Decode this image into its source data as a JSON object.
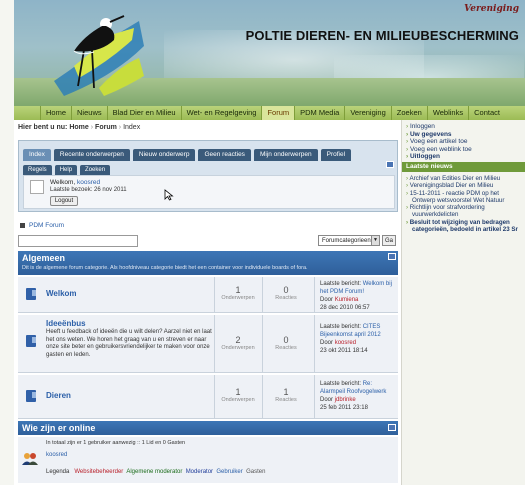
{
  "header": {
    "site_sup": "Vereniging",
    "site_title": "POLTIE DIEREN- EN MILIEUBESCHERMING"
  },
  "nav": {
    "items": [
      "Home",
      "Nieuws",
      "Blad Dier en Milieu",
      "Wet- en Regelgeving",
      "Forum",
      "PDM Media",
      "Vereniging",
      "Zoeken",
      "Weblinks",
      "Contact"
    ],
    "active_index": 4
  },
  "breadcrumb": {
    "prefix": "Hier bent u nu:",
    "home": "Home",
    "forum": "Forum",
    "index": "Index"
  },
  "tabs": {
    "primary": [
      "Index",
      "Recente onderwerpen",
      "Nieuw onderwerp",
      "Geen reacties",
      "Mijn onderwerpen",
      "Profiel"
    ],
    "secondary": [
      "Regels",
      "Help",
      "Zoeken"
    ]
  },
  "user": {
    "welcome_label": "Welkom,",
    "username": "koosred",
    "last_visit": "Laatste bezoek: 26 nov 2011",
    "logout": "Logout"
  },
  "forum_link": "PDM Forum",
  "search": {
    "value": "",
    "select": "Forumcategorieen",
    "go": "Ga"
  },
  "category": {
    "title": "Algemeen",
    "description": "Dit is de algemene forum categorie. Als hoofdniveau categorie biedt het een container voor individuele boards of fora."
  },
  "forums": [
    {
      "name": "Welkom",
      "description": "",
      "topics": "1",
      "topics_label": "Onderwerpen",
      "replies": "0",
      "replies_label": "Reacties",
      "last_label": "Laatste bericht:",
      "last_title": "Welkom bij het PDM Forum!",
      "by_label": "Door",
      "last_user": "Kumiena",
      "last_date": "28 dec 2010 06:57"
    },
    {
      "name": "Ideeënbus",
      "description": "Heeft u feedback of ideeën die u wilt delen? Aarzel niet en laat het ons weten. We horen het graag van u en streven er naar onze site beter en gebruikersvriendelijker te maken voor onze gasten en leden.",
      "topics": "2",
      "topics_label": "Onderwerpen",
      "replies": "0",
      "replies_label": "Reacties",
      "last_label": "Laatste bericht:",
      "last_title": "CITES Bijeenkomst april 2012",
      "by_label": "Door",
      "last_user": "koosred",
      "last_date": "23 okt 2011 18:14"
    },
    {
      "name": "Dieren",
      "description": "",
      "topics": "1",
      "topics_label": "Onderwerpen",
      "replies": "1",
      "replies_label": "Reacties",
      "last_label": "Laatste bericht:",
      "last_title": "Re: Alarmpeil Roofvogelwerk",
      "by_label": "Door",
      "last_user": "jdbrinke",
      "last_date": "25 feb 2011 23:18"
    }
  ],
  "online": {
    "title": "Wie zijn er online",
    "summary": "In totaal zijn er 1 gebruiker aanwezig :: 1 Lid en 0 Gasten",
    "user": "koosred",
    "legend_label": "Legenda",
    "legend_items": [
      "Websitebeheerder",
      "Algemene moderator",
      "Moderator",
      "Gebruiker",
      "Gasten"
    ]
  },
  "sidebar": {
    "links": [
      "Inloggen",
      "Uw gegevens",
      "Voeg een artikel toe",
      "Voeg een weblink toe",
      "Uitloggen"
    ],
    "news_title": "Laatste nieuws",
    "news": [
      "Archief van Edities Dier en Milieu",
      "Verenigingsblad Dier en Milieu",
      "15-11-2011 - reactie PDM op het Ontwerp wetsvoorstel Wet Natuur",
      "Richtlijn voor strafvordering vuurwerkdelicten",
      "Besluit tot wijziging van bedragen categorieën, bedoeld in artikel 23 Sr"
    ]
  },
  "colors": {
    "nav_bg": "#a9c867",
    "category_bg": "#3568a8",
    "link": "#2b5fa8",
    "accent_red": "#b8212b"
  }
}
